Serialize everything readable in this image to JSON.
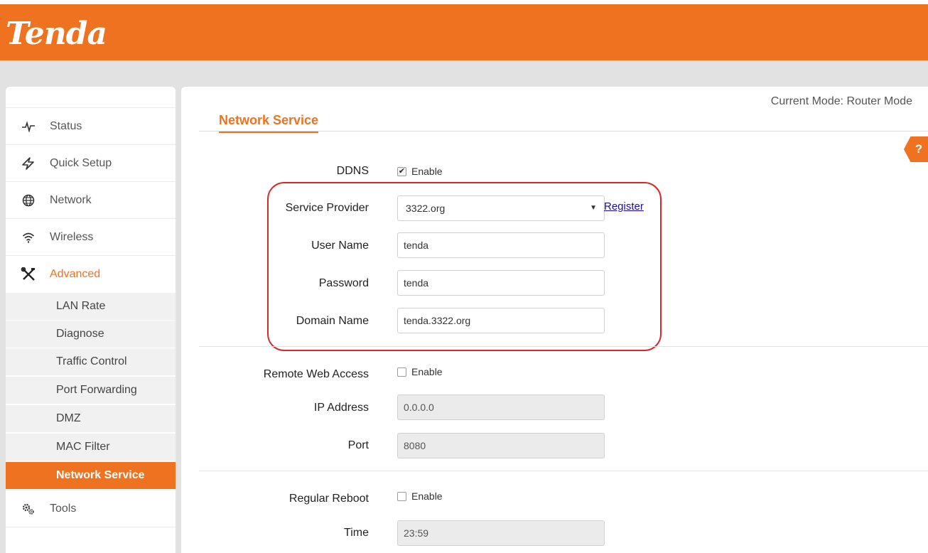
{
  "header": {
    "logo_text": "Tenda",
    "brand_color": "#ee7220"
  },
  "sidebar": {
    "items": [
      {
        "label": "Status",
        "icon": "pulse-icon"
      },
      {
        "label": "Quick Setup",
        "icon": "lightning-icon"
      },
      {
        "label": "Network",
        "icon": "globe-icon"
      },
      {
        "label": "Wireless",
        "icon": "wifi-icon"
      },
      {
        "label": "Advanced",
        "icon": "tools-icon",
        "active": true
      },
      {
        "label": "Tools",
        "icon": "gears-icon"
      }
    ],
    "advanced_subitems": [
      {
        "label": "LAN Rate"
      },
      {
        "label": "Diagnose"
      },
      {
        "label": "Traffic Control"
      },
      {
        "label": "Port Forwarding"
      },
      {
        "label": "DMZ"
      },
      {
        "label": "MAC Filter"
      },
      {
        "label": "Network Service",
        "active": true
      }
    ]
  },
  "content": {
    "mode_text": "Current Mode: Router Mode",
    "page_title": "Network Service",
    "help_label": "?",
    "ddns": {
      "label": "DDNS",
      "enable_label": "Enable",
      "enabled": true,
      "service_provider_label": "Service Provider",
      "service_provider_value": "3322.org",
      "register_link": "Register",
      "user_name_label": "User Name",
      "user_name_value": "tenda",
      "password_label": "Password",
      "password_value": "tenda",
      "domain_name_label": "Domain Name",
      "domain_name_value": "tenda.3322.org"
    },
    "remote_web_access": {
      "label": "Remote Web Access",
      "enable_label": "Enable",
      "enabled": false,
      "ip_address_label": "IP Address",
      "ip_address_value": "0.0.0.0",
      "port_label": "Port",
      "port_value": "8080"
    },
    "regular_reboot": {
      "label": "Regular Reboot",
      "enable_label": "Enable",
      "enabled": false,
      "time_label": "Time",
      "time_value": "23:59"
    }
  }
}
